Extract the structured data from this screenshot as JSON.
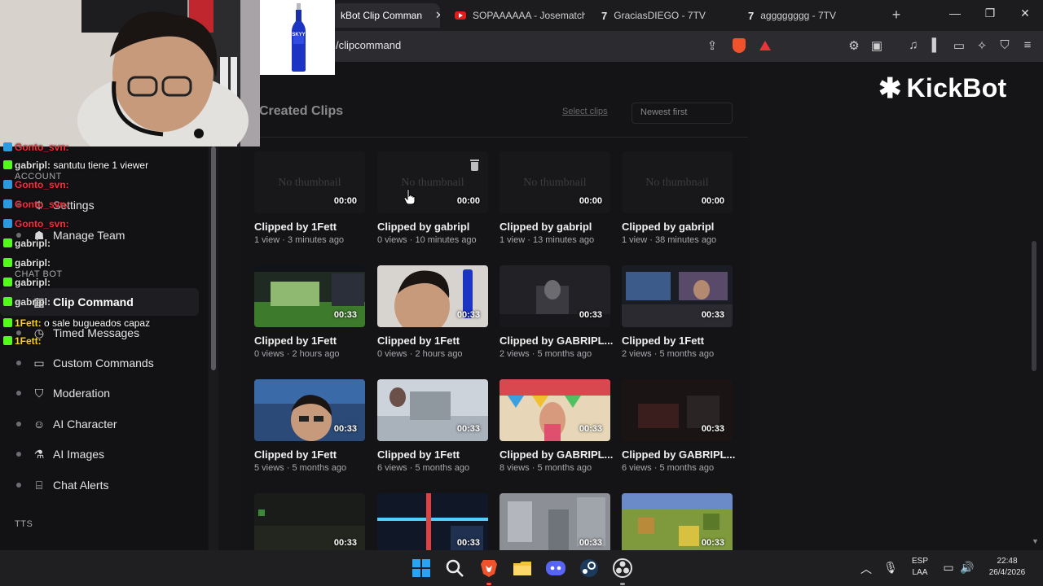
{
  "browser": {
    "tabs": [
      {
        "label": "kBot Clip Comman",
        "active": true,
        "favicon": "kickbot-icon"
      },
      {
        "label": "SOPAAAAAA - Josematch",
        "active": false,
        "favicon": "youtube-icon"
      },
      {
        "label": "GraciasDIEGO - 7TV",
        "active": false,
        "favicon": "7tv-icon"
      },
      {
        "label": "agggggggg - 7TV",
        "active": false,
        "favicon": "7tv-icon"
      }
    ],
    "tab_close": "✕",
    "new_tab": "+",
    "window_controls": [
      "—",
      "❐",
      "✕"
    ],
    "url": "/clipcommand",
    "brave_count": "2"
  },
  "logo": {
    "mark": "✱",
    "text": "KickBot"
  },
  "sidebar": {
    "section_account": "ACCOUNT",
    "section_chatbot": "CHAT BOT",
    "section_tts": "TTS",
    "items": [
      {
        "label": "Settings",
        "icon": "gear-icon",
        "glyph": "⚙"
      },
      {
        "label": "Manage Team",
        "icon": "team-icon",
        "glyph": "☗"
      },
      {
        "label": "Clip Command",
        "icon": "clip-icon",
        "glyph": "▤",
        "active": true
      },
      {
        "label": "Timed Messages",
        "icon": "timer-icon",
        "glyph": "◷"
      },
      {
        "label": "Custom Commands",
        "icon": "command-icon",
        "glyph": "▭"
      },
      {
        "label": "Moderation",
        "icon": "shield-icon",
        "glyph": "⛉"
      },
      {
        "label": "AI Character",
        "icon": "character-icon",
        "glyph": "☺"
      },
      {
        "label": "AI Images",
        "icon": "flask-icon",
        "glyph": "⚗"
      },
      {
        "label": "Chat Alerts",
        "icon": "gift-icon",
        "glyph": "⌸"
      }
    ]
  },
  "main": {
    "heading": "Created Clips",
    "select_link": "Select clips",
    "sort_select": "Newest first",
    "no_thumbnail": "No thumbnail",
    "clips": [
      {
        "title": "Clipped by 1Fett",
        "meta": "1 view · 3 minutes ago",
        "duration": "00:00",
        "thumb": "none"
      },
      {
        "title": "Clipped by gabripl",
        "meta": "0 views · 10 minutes ago",
        "duration": "00:00",
        "thumb": "none",
        "trash": true
      },
      {
        "title": "Clipped by gabripl",
        "meta": "1 view · 13 minutes ago",
        "duration": "00:00",
        "thumb": "none"
      },
      {
        "title": "Clipped by gabripl",
        "meta": "1 view · 38 minutes ago",
        "duration": "00:00",
        "thumb": "none"
      },
      {
        "title": "Clipped by 1Fett",
        "meta": "0 views · 2 hours ago",
        "duration": "00:33",
        "thumb": "game-green"
      },
      {
        "title": "Clipped by 1Fett",
        "meta": "0 views · 2 hours ago",
        "duration": "00:33",
        "thumb": "webcam-bottle"
      },
      {
        "title": "Clipped by GABRIPL...",
        "meta": "2 views · 5 months ago",
        "duration": "00:33",
        "thumb": "dark-room"
      },
      {
        "title": "Clipped by 1Fett",
        "meta": "2 views · 5 months ago",
        "duration": "00:33",
        "thumb": "stream-desk"
      },
      {
        "title": "Clipped by 1Fett",
        "meta": "5 views · 5 months ago",
        "duration": "00:33",
        "thumb": "webcam-blue"
      },
      {
        "title": "Clipped by 1Fett",
        "meta": "6 views · 5 months ago",
        "duration": "00:33",
        "thumb": "snow-game"
      },
      {
        "title": "Clipped by GABRIPL...",
        "meta": "8 views · 5 months ago",
        "duration": "00:33",
        "thumb": "party"
      },
      {
        "title": "Clipped by GABRIPL...",
        "meta": "6 views · 5 months ago",
        "duration": "00:33",
        "thumb": "dark-red"
      },
      {
        "title": "",
        "meta": "",
        "duration": "00:33",
        "thumb": "dark-game"
      },
      {
        "title": "",
        "meta": "",
        "duration": "00:33",
        "thumb": "neon-game"
      },
      {
        "title": "",
        "meta": "",
        "duration": "00:33",
        "thumb": "city-game"
      },
      {
        "title": "",
        "meta": "",
        "duration": "00:33",
        "thumb": "minecraft"
      }
    ]
  },
  "overlay": {
    "chat": [
      {
        "user": "Gonto_svn:",
        "msg": "",
        "color": "u2"
      },
      {
        "user": "gabripl:",
        "msg": "santutu tiene 1 viewer",
        "color": "u1"
      },
      {
        "user": "Gonto_svn:",
        "msg": "",
        "color": "u2"
      },
      {
        "user": "Gonto_svn:",
        "msg": "",
        "color": "u2"
      },
      {
        "user": "Gonto_svn:",
        "msg": "",
        "color": "u2"
      },
      {
        "user": "gabripl:",
        "msg": "",
        "color": "u1"
      },
      {
        "user": "gabripl:",
        "msg": "",
        "color": "u1"
      },
      {
        "user": "gabripl:",
        "msg": "",
        "color": "u1"
      },
      {
        "user": "gabripl:",
        "msg": "",
        "color": "u1"
      },
      {
        "user": "1Fett:",
        "msg": "o sale bugueados capaz",
        "color": "u3"
      },
      {
        "user": "1Fett:",
        "msg": "",
        "color": "u3"
      }
    ],
    "bottle_label": "SKYY"
  },
  "taskbar": {
    "icons": [
      "windows-start-icon",
      "search-icon",
      "brave-browser-icon",
      "file-explorer-icon",
      "discord-icon",
      "steam-icon",
      "obs-icon"
    ],
    "tray_up": "︿",
    "lang_top": "ESP",
    "lang_bottom": "LAA",
    "time": "22:48",
    "date": "26/4/2026"
  },
  "colors": {
    "accent": "#53fc18",
    "bg": "#151517",
    "brave": "#f0532b"
  }
}
